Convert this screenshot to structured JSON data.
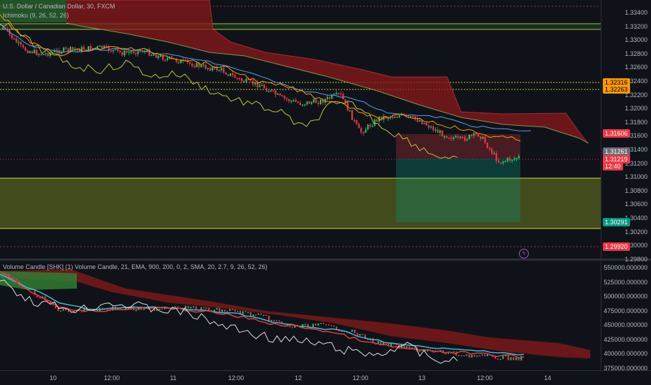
{
  "main": {
    "title": "U.S. Dollar / Canadian Dollar, 30, FXCM",
    "indicator": "Ichimoku (9, 26, 52, 26)"
  },
  "volume": {
    "title": "Volume Candle [SHK] (1) Volume Candle, 21, EMA, 900, 200, 0, 2, SMA, 20, 2.7, 9, 26, 52, 26)"
  },
  "price_axis": [
    "1.33400",
    "1.33200",
    "1.33000",
    "1.32800",
    "1.32600",
    "1.32400",
    "1.32200",
    "1.32000",
    "1.31800",
    "1.31600",
    "1.31400",
    "1.31200",
    "1.31000",
    "1.30800",
    "1.30600",
    "1.30400",
    "1.30200",
    "1.30000",
    "1.29800"
  ],
  "price_tags": [
    {
      "label": "1.32316",
      "color": "#ff9800",
      "text": "#000000"
    },
    {
      "label": "1.32263",
      "color": "#ff9800",
      "text": "#000000"
    },
    {
      "label": "1.31606",
      "color": "#f23645",
      "text": "#ffffff"
    },
    {
      "label": "1.31261",
      "color": "#6a6d78",
      "text": "#ffffff"
    },
    {
      "label": "1.31219",
      "color": "#f23645",
      "text": "#ffffff"
    },
    {
      "label": "12:40",
      "color": "#f23645",
      "text": "#ffffff"
    },
    {
      "label": "1.30291",
      "color": "#089981",
      "text": "#ffffff"
    },
    {
      "label": "1.29920",
      "color": "#f23645",
      "text": "#ffffff"
    }
  ],
  "volume_axis": [
    "550000.000000",
    "525000.000000",
    "500000.000000",
    "475000.000000",
    "450000.000000",
    "425000.000000",
    "400000.000000",
    "375000.000000"
  ],
  "time_axis": [
    "10",
    "12:00",
    "11",
    "12:00",
    "12",
    "12:00",
    "13",
    "12:00",
    "14"
  ],
  "marker_icon": "lightning-icon",
  "colors": {
    "bull": "#26a69a",
    "bear": "#f23645",
    "cloud_bear": "#8b1a1a",
    "cloud_bull": "#2e7d32",
    "zone": "#6b7a1e"
  }
}
